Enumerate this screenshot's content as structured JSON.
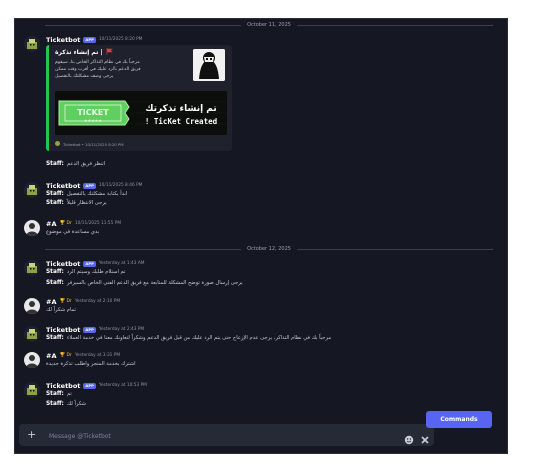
{
  "divider_top": "October 11, 2025",
  "divider_mid": "October 12, 2025",
  "msg1": {
    "name": "Ticketbot",
    "badge": "APP",
    "time": "10/11/2025 8:20 PM",
    "embed": {
      "title": "تم إنشاء تذكرة |",
      "desc1": "مرحباً بك في نظام التذاكر الخاص بنا، سيقوم",
      "desc2": "فريق الدعم بالرد عليك في أقرب وقت ممكن",
      "desc3": "يرجى وصف مشكلتك بالتفصيل",
      "banner_left": "TICKET",
      "banner_ar": "تم إنشاء تذكرتك",
      "banner_en": "! TicKet Created",
      "footer": "Ticketbot • 10/11/2025 8:20 PM"
    },
    "staff_line": "اتنظر فريق الدعم"
  },
  "msg2": {
    "name": "Ticketbot",
    "badge": "APP",
    "time": "10/11/2025 8:46 PM",
    "line1_label": "Staff:",
    "line1": "ابدأ بكتابة مشكلتك بالتفصيل",
    "line2_label": "Staff:",
    "line2": "يرجى الانتظار قليلاً"
  },
  "msg3": {
    "name": "#A",
    "tag": "Dr",
    "time": "10/11/2025 11:55 PM",
    "line1": "بدي مساعدة في موضوع"
  },
  "msg4": {
    "name": "Ticketbot",
    "badge": "APP",
    "time": "Yesterday at 1:43 AM",
    "line1_label": "Staff:",
    "line1": "تم استلام طلبك وسيتم الرد",
    "line2_label": "Staff:",
    "line2": "يرجى إرسال صورة توضح المشكلة للمتابعة مع فريق الدعم الفني الخاص بالسيرفر"
  },
  "msg5": {
    "name": "#A",
    "tag": "Dr",
    "time": "Yesterday at 2:10 PM",
    "line1": "تمام شكراً لك"
  },
  "msg6": {
    "name": "Ticketbot",
    "badge": "APP",
    "time": "Yesterday at 2:43 PM",
    "line1_label": "Staff:",
    "line1": "مرحباً بك في نظام التذاكر، يرجى عدم الإزعاج حتى يتم الرد عليك من قبل فريق الدعم وشكراً لتعاونك معنا في خدمة العملاء",
    "line2_label": "Staff:",
    "line2": "تم تحويل التذكرة إلى القسم المختص وسيتم التواصل معك قريباً"
  },
  "msg7": {
    "name": "#A",
    "tag": "Dr",
    "time": "Yesterday at 3:31 PM",
    "line1": "اشترك بخدمة المتجر واطلب تذكرة جديدة"
  },
  "msg8": {
    "name": "Ticketbot",
    "badge": "APP",
    "time": "Yesterday at 10:53 PM",
    "line1_label": "Staff:",
    "line1": "تم",
    "line2_label": "Staff:",
    "line2": "شكراً لك"
  },
  "composer": {
    "placeholder": "Message @Ticketbot",
    "commands_label": "Commands"
  },
  "colors": {
    "accent": "#5865f2",
    "embed_bar": "#23c552",
    "background": "#151722"
  }
}
